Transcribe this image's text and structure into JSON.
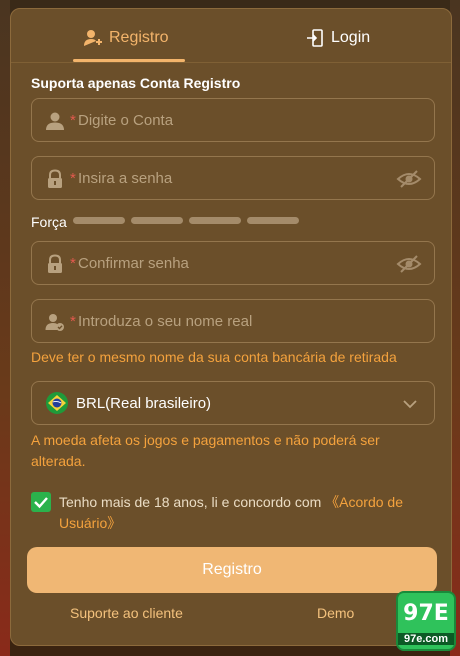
{
  "tabs": {
    "register": "Registro",
    "login": "Login"
  },
  "section_title": "Suporta apenas Conta Registro",
  "fields": {
    "account": {
      "required_mark": "*",
      "placeholder": "Digite o Conta"
    },
    "password": {
      "required_mark": "*",
      "placeholder": "Insira a senha"
    },
    "confirm": {
      "required_mark": "*",
      "placeholder": "Confirmar senha"
    },
    "real_name": {
      "required_mark": "*",
      "placeholder": "Introduza o seu nome real"
    }
  },
  "strength": {
    "label": "Força",
    "level": 0,
    "segments": 4
  },
  "real_name_note": "Deve ter o mesmo nome da sua conta bancária de retirada",
  "currency": {
    "selected": "BRL(Real brasileiro)",
    "flag_icon": "brazil-flag-icon"
  },
  "currency_note": "A moeda afeta os jogos e pagamentos e não poderá ser alterada.",
  "terms": {
    "checked": true,
    "text": "Tenho mais de 18 anos, li e concordo com ",
    "link": "《Acordo de Usuário》"
  },
  "submit_label": "Registro",
  "footer": {
    "support": "Suporte ao cliente",
    "demo": "Demo"
  },
  "badge": {
    "title": "97E",
    "domain": "97e.com"
  },
  "colors": {
    "accent": "#f3b46b",
    "card": "#6b4f2a",
    "required": "#e25a4e",
    "note": "#f4a23d",
    "checkbox": "#2bb24c"
  }
}
